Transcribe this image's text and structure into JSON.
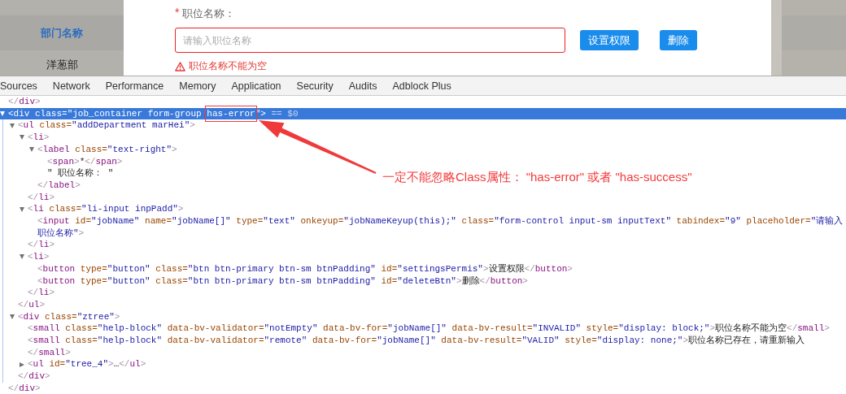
{
  "left_panel": {
    "column_header": "部门名称",
    "rows": [
      "洋葱部"
    ]
  },
  "form": {
    "required_mark": "*",
    "label": "职位名称：",
    "input": {
      "placeholder": "请输入职位名称",
      "invalid": true
    },
    "buttons": [
      "设置权限",
      "删除"
    ],
    "error_message": "职位名称不能为空"
  },
  "devtools": {
    "tabs": [
      "Sources",
      "Network",
      "Performance",
      "Memory",
      "Application",
      "Security",
      "Audits",
      "Adblock Plus"
    ],
    "dom_tree": [
      {
        "selected": false,
        "tokens": [
          {
            "kind": "p",
            "text": "</"
          },
          {
            "kind": "tag",
            "text": "div"
          },
          {
            "kind": "p",
            "text": ">"
          }
        ]
      },
      {
        "selected": true,
        "expanded": true,
        "tokens": [
          {
            "kind": "p",
            "text": "<"
          },
          {
            "kind": "tag",
            "text": "div"
          },
          {
            "kind": "attr",
            "text": " class="
          },
          {
            "kind": "val",
            "text": "\"job_container form-group "
          },
          {
            "kind": "val",
            "text": "has-error",
            "boxed": true
          },
          {
            "kind": "val",
            "text": "\""
          },
          {
            "kind": "p",
            "text": ">"
          },
          {
            "kind": "ref",
            "text": " == $0"
          }
        ],
        "close": [
          {
            "kind": "p",
            "text": "</"
          },
          {
            "kind": "tag",
            "text": "div"
          },
          {
            "kind": "p",
            "text": ">"
          }
        ],
        "children": [
          {
            "selected": false,
            "expanded": true,
            "tokens": [
              {
                "kind": "p",
                "text": "<"
              },
              {
                "kind": "tag",
                "text": "ul"
              },
              {
                "kind": "attr",
                "text": " class="
              },
              {
                "kind": "val",
                "text": "\"addDepartment marHei\""
              },
              {
                "kind": "p",
                "text": ">"
              }
            ],
            "close": [
              {
                "kind": "p",
                "text": "</"
              },
              {
                "kind": "tag",
                "text": "ul"
              },
              {
                "kind": "p",
                "text": ">"
              }
            ],
            "children": [
              {
                "selected": false,
                "expanded": true,
                "tokens": [
                  {
                    "kind": "p",
                    "text": "<"
                  },
                  {
                    "kind": "tag",
                    "text": "li"
                  },
                  {
                    "kind": "p",
                    "text": ">"
                  }
                ],
                "close": [
                  {
                    "kind": "p",
                    "text": "</"
                  },
                  {
                    "kind": "tag",
                    "text": "li"
                  },
                  {
                    "kind": "p",
                    "text": ">"
                  }
                ],
                "children": [
                  {
                    "selected": false,
                    "expanded": true,
                    "tokens": [
                      {
                        "kind": "p",
                        "text": "<"
                      },
                      {
                        "kind": "tag",
                        "text": "label"
                      },
                      {
                        "kind": "attr",
                        "text": " class="
                      },
                      {
                        "kind": "val",
                        "text": "\"text-right\""
                      },
                      {
                        "kind": "p",
                        "text": ">"
                      }
                    ],
                    "close": [
                      {
                        "kind": "p",
                        "text": "</"
                      },
                      {
                        "kind": "tag",
                        "text": "label"
                      },
                      {
                        "kind": "p",
                        "text": ">"
                      }
                    ],
                    "children": [
                      {
                        "selected": false,
                        "tokens": [
                          {
                            "kind": "p",
                            "text": "<"
                          },
                          {
                            "kind": "tag",
                            "text": "span"
                          },
                          {
                            "kind": "p",
                            "text": ">"
                          },
                          {
                            "kind": "text",
                            "text": "*"
                          },
                          {
                            "kind": "p",
                            "text": "</"
                          },
                          {
                            "kind": "tag",
                            "text": "span"
                          },
                          {
                            "kind": "p",
                            "text": ">"
                          }
                        ]
                      },
                      {
                        "selected": false,
                        "tokens": [
                          {
                            "kind": "text",
                            "text": "\" 职位名称： \""
                          }
                        ]
                      }
                    ]
                  }
                ]
              },
              {
                "selected": false,
                "expanded": true,
                "tokens": [
                  {
                    "kind": "p",
                    "text": "<"
                  },
                  {
                    "kind": "tag",
                    "text": "li"
                  },
                  {
                    "kind": "attr",
                    "text": " class="
                  },
                  {
                    "kind": "val",
                    "text": "\"li-input inpPadd\""
                  },
                  {
                    "kind": "p",
                    "text": ">"
                  }
                ],
                "close": [
                  {
                    "kind": "p",
                    "text": "</"
                  },
                  {
                    "kind": "tag",
                    "text": "li"
                  },
                  {
                    "kind": "p",
                    "text": ">"
                  }
                ],
                "children": [
                  {
                    "selected": false,
                    "tokens": [
                      {
                        "kind": "p",
                        "text": "<"
                      },
                      {
                        "kind": "tag",
                        "text": "input"
                      },
                      {
                        "kind": "attr",
                        "text": " id="
                      },
                      {
                        "kind": "val",
                        "text": "\"jobName\""
                      },
                      {
                        "kind": "attr",
                        "text": " name="
                      },
                      {
                        "kind": "val",
                        "text": "\"jobName[]\""
                      },
                      {
                        "kind": "attr",
                        "text": " type="
                      },
                      {
                        "kind": "val",
                        "text": "\"text\""
                      },
                      {
                        "kind": "attr",
                        "text": " onkeyup="
                      },
                      {
                        "kind": "val",
                        "text": "\"jobNameKeyup(this);\""
                      },
                      {
                        "kind": "attr",
                        "text": " class="
                      },
                      {
                        "kind": "val",
                        "text": "\"form-control input-sm inputText\""
                      },
                      {
                        "kind": "attr",
                        "text": " tabindex="
                      },
                      {
                        "kind": "val",
                        "text": "\"9\""
                      },
                      {
                        "kind": "attr",
                        "text": " placeholder="
                      },
                      {
                        "kind": "val",
                        "text": "\"请输入职位名称\""
                      },
                      {
                        "kind": "p",
                        "text": ">"
                      }
                    ]
                  }
                ]
              },
              {
                "selected": false,
                "expanded": true,
                "tokens": [
                  {
                    "kind": "p",
                    "text": "<"
                  },
                  {
                    "kind": "tag",
                    "text": "li"
                  },
                  {
                    "kind": "p",
                    "text": ">"
                  }
                ],
                "close": [
                  {
                    "kind": "p",
                    "text": "</"
                  },
                  {
                    "kind": "tag",
                    "text": "li"
                  },
                  {
                    "kind": "p",
                    "text": ">"
                  }
                ],
                "children": [
                  {
                    "selected": false,
                    "tokens": [
                      {
                        "kind": "p",
                        "text": "<"
                      },
                      {
                        "kind": "tag",
                        "text": "button"
                      },
                      {
                        "kind": "attr",
                        "text": " type="
                      },
                      {
                        "kind": "val",
                        "text": "\"button\""
                      },
                      {
                        "kind": "attr",
                        "text": " class="
                      },
                      {
                        "kind": "val",
                        "text": "\"btn btn-primary btn-sm btnPadding\""
                      },
                      {
                        "kind": "attr",
                        "text": " id="
                      },
                      {
                        "kind": "val",
                        "text": "\"settingsPermis\""
                      },
                      {
                        "kind": "p",
                        "text": ">"
                      },
                      {
                        "kind": "text",
                        "text": "设置权限"
                      },
                      {
                        "kind": "p",
                        "text": "</"
                      },
                      {
                        "kind": "tag",
                        "text": "button"
                      },
                      {
                        "kind": "p",
                        "text": ">"
                      }
                    ]
                  },
                  {
                    "selected": false,
                    "tokens": [
                      {
                        "kind": "p",
                        "text": "<"
                      },
                      {
                        "kind": "tag",
                        "text": "button"
                      },
                      {
                        "kind": "attr",
                        "text": " type="
                      },
                      {
                        "kind": "val",
                        "text": "\"button\""
                      },
                      {
                        "kind": "attr",
                        "text": " class="
                      },
                      {
                        "kind": "val",
                        "text": "\"btn btn-primary btn-sm btnPadding\""
                      },
                      {
                        "kind": "attr",
                        "text": " id="
                      },
                      {
                        "kind": "val",
                        "text": "\"deleteBtn\""
                      },
                      {
                        "kind": "p",
                        "text": ">"
                      },
                      {
                        "kind": "text",
                        "text": "删除"
                      },
                      {
                        "kind": "p",
                        "text": "</"
                      },
                      {
                        "kind": "tag",
                        "text": "button"
                      },
                      {
                        "kind": "p",
                        "text": ">"
                      }
                    ]
                  }
                ]
              }
            ]
          },
          {
            "selected": false,
            "expanded": true,
            "tokens": [
              {
                "kind": "p",
                "text": "<"
              },
              {
                "kind": "tag",
                "text": "div"
              },
              {
                "kind": "attr",
                "text": " class="
              },
              {
                "kind": "val",
                "text": "\"ztree\""
              },
              {
                "kind": "p",
                "text": ">"
              }
            ],
            "close": [
              {
                "kind": "p",
                "text": "</"
              },
              {
                "kind": "tag",
                "text": "div"
              },
              {
                "kind": "p",
                "text": ">"
              }
            ],
            "children": [
              {
                "selected": false,
                "tokens": [
                  {
                    "kind": "p",
                    "text": "<"
                  },
                  {
                    "kind": "tag",
                    "text": "small"
                  },
                  {
                    "kind": "attr",
                    "text": " class="
                  },
                  {
                    "kind": "val",
                    "text": "\"help-block\""
                  },
                  {
                    "kind": "attr",
                    "text": " data-bv-validator="
                  },
                  {
                    "kind": "val",
                    "text": "\"notEmpty\""
                  },
                  {
                    "kind": "attr",
                    "text": " data-bv-for="
                  },
                  {
                    "kind": "val",
                    "text": "\"jobName[]\""
                  },
                  {
                    "kind": "attr",
                    "text": " data-bv-result="
                  },
                  {
                    "kind": "val",
                    "text": "\"INVALID\""
                  },
                  {
                    "kind": "attr",
                    "text": " style="
                  },
                  {
                    "kind": "val",
                    "text": "\"display: block;\""
                  },
                  {
                    "kind": "p",
                    "text": ">"
                  },
                  {
                    "kind": "text",
                    "text": "职位名称不能为空"
                  },
                  {
                    "kind": "p",
                    "text": "</"
                  },
                  {
                    "kind": "tag",
                    "text": "small"
                  },
                  {
                    "kind": "p",
                    "text": ">"
                  }
                ]
              },
              {
                "selected": false,
                "tokens": [
                  {
                    "kind": "p",
                    "text": "<"
                  },
                  {
                    "kind": "tag",
                    "text": "small"
                  },
                  {
                    "kind": "attr",
                    "text": " class="
                  },
                  {
                    "kind": "val",
                    "text": "\"help-block\""
                  },
                  {
                    "kind": "attr",
                    "text": " data-bv-validator="
                  },
                  {
                    "kind": "val",
                    "text": "\"remote\""
                  },
                  {
                    "kind": "attr",
                    "text": " data-bv-for="
                  },
                  {
                    "kind": "val",
                    "text": "\"jobName[]\""
                  },
                  {
                    "kind": "attr",
                    "text": " data-bv-result="
                  },
                  {
                    "kind": "val",
                    "text": "\"VALID\""
                  },
                  {
                    "kind": "attr",
                    "text": " style="
                  },
                  {
                    "kind": "val",
                    "text": "\"display: none;\""
                  },
                  {
                    "kind": "p",
                    "text": ">"
                  },
                  {
                    "kind": "text",
                    "text": "职位名称已存在，请重新输入"
                  }
                ],
                "close": [
                  {
                    "kind": "p",
                    "text": "</"
                  },
                  {
                    "kind": "tag",
                    "text": "small"
                  },
                  {
                    "kind": "p",
                    "text": ">"
                  }
                ]
              },
              {
                "selected": false,
                "expanded": false,
                "tokens": [
                  {
                    "kind": "p",
                    "text": "<"
                  },
                  {
                    "kind": "tag",
                    "text": "ul"
                  },
                  {
                    "kind": "attr",
                    "text": " id="
                  },
                  {
                    "kind": "val",
                    "text": "\"tree_4\""
                  },
                  {
                    "kind": "p",
                    "text": ">"
                  },
                  {
                    "kind": "text",
                    "text": "…"
                  },
                  {
                    "kind": "p",
                    "text": "</"
                  },
                  {
                    "kind": "tag",
                    "text": "ul"
                  },
                  {
                    "kind": "p",
                    "text": ">"
                  }
                ]
              }
            ]
          }
        ]
      }
    ]
  },
  "annotation": {
    "text": "一定不能忽略Class属性： \"has-error\" 或者 \"has-success\""
  }
}
